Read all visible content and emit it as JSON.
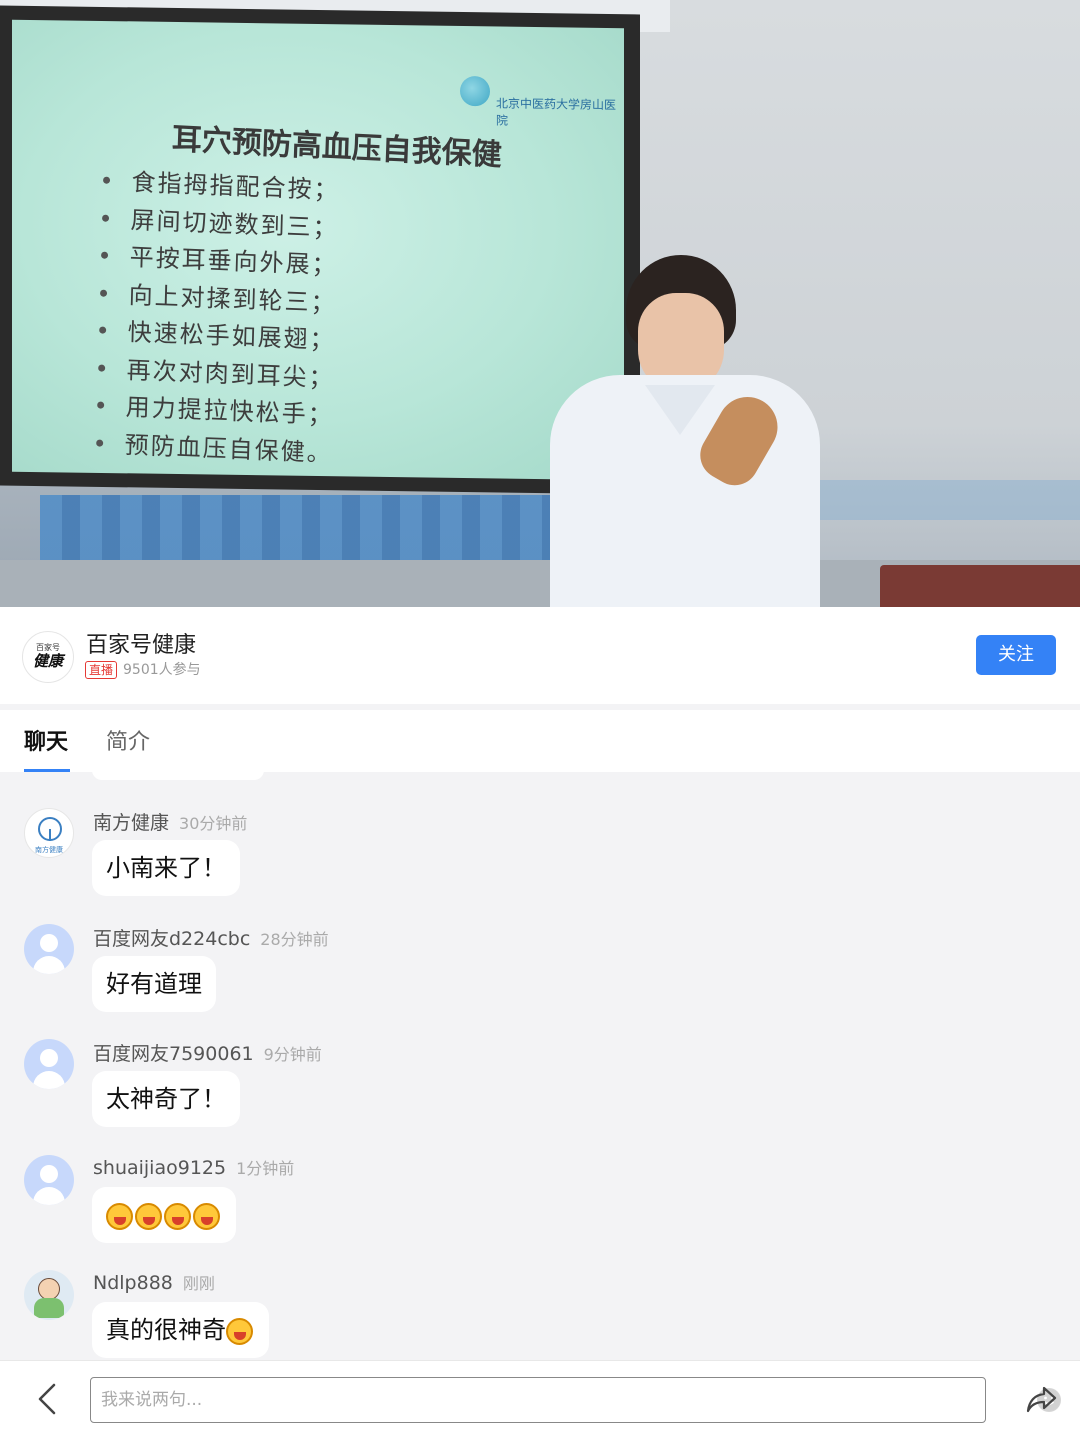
{
  "video": {
    "slide": {
      "logo_text": "北京中医药大学房山医院",
      "title": "耳穴预防高血压自我保健",
      "bullets": [
        "食指拇指配合按；",
        "屏间切迹数到三；",
        "平按耳垂向外展；",
        "向上对揉到轮三；",
        "快速松手如展翅；",
        "再次对肉到耳尖；",
        "用力提拉快松手；",
        "预防血压自保健。"
      ]
    }
  },
  "channel": {
    "avatar_line1": "百家号",
    "avatar_line2": "健康",
    "name": "百家号健康",
    "live_badge": "直播",
    "participants": "9501人参与",
    "follow_label": "关注"
  },
  "tabs": [
    {
      "label": "聊天",
      "active": true
    },
    {
      "label": "简介",
      "active": false
    }
  ],
  "messages": [
    {
      "user": "南方健康",
      "time": "30分钟前",
      "text": "小南来了！",
      "avatar": "nanfang-logo",
      "avatar_label": "南方健康"
    },
    {
      "user": "百度网友d224cbc",
      "time": "28分钟前",
      "text": "好有道理",
      "avatar": "default-user"
    },
    {
      "user": "百度网友7590061",
      "time": "9分钟前",
      "text": "太神奇了！",
      "avatar": "default-user"
    },
    {
      "user": "shuaijiao9125",
      "time": "1分钟前",
      "text": "",
      "emoji_count": 4,
      "emoji": "crying-laughing-face",
      "avatar": "default-user"
    },
    {
      "user": "Ndlp888",
      "time": "刚刚",
      "text": "真的很神奇",
      "trailing_emoji": "grinning-face",
      "avatar": "cartoon-kid"
    }
  ],
  "input": {
    "placeholder": "我来说两句...",
    "value": ""
  },
  "icons": {
    "back": "chevron-left-icon",
    "emoji": "emoji-icon",
    "share": "share-arrow-icon"
  },
  "colors": {
    "accent": "#3482f6",
    "live": "#e53935",
    "background": "#f3f3f5"
  }
}
